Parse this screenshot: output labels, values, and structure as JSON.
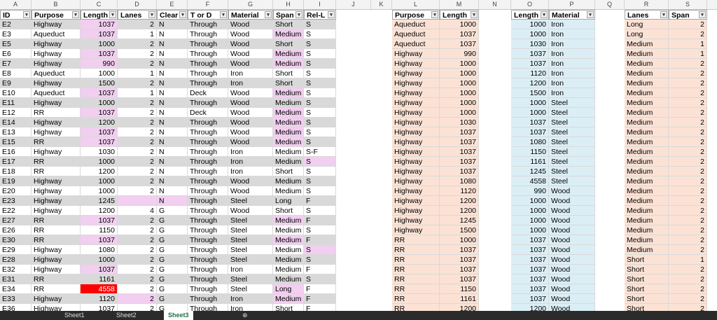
{
  "columns": [
    "A",
    "B",
    "C",
    "D",
    "E",
    "F",
    "G",
    "H",
    "I",
    "J",
    "K",
    "L",
    "M",
    "N",
    "O",
    "P",
    "Q",
    "R",
    "S"
  ],
  "main_headers": [
    "ID",
    "Purpose",
    "Length",
    "Lanes",
    "Clear",
    "T or D",
    "Material",
    "Span",
    "Rel-L"
  ],
  "main_rows": [
    [
      "E2",
      "Highway",
      "1037",
      "2",
      "N",
      "Through",
      "Wood",
      "Short",
      "S"
    ],
    [
      "E3",
      "Aqueduct",
      "1037",
      "1",
      "N",
      "Through",
      "Wood",
      "Medium",
      "S"
    ],
    [
      "E5",
      "Highway",
      "1000",
      "2",
      "N",
      "Through",
      "Wood",
      "Short",
      "S"
    ],
    [
      "E6",
      "Highway",
      "1037",
      "2",
      "N",
      "Through",
      "Wood",
      "Medium",
      "S"
    ],
    [
      "E7",
      "Highway",
      "990",
      "2",
      "N",
      "Through",
      "Wood",
      "Medium",
      "S"
    ],
    [
      "E8",
      "Aqueduct",
      "1000",
      "1",
      "N",
      "Through",
      "Iron",
      "Short",
      "S"
    ],
    [
      "E9",
      "Highway",
      "1500",
      "2",
      "N",
      "Through",
      "Iron",
      "Short",
      "S"
    ],
    [
      "E10",
      "Aqueduct",
      "1037",
      "1",
      "N",
      "Deck",
      "Wood",
      "Medium",
      "S"
    ],
    [
      "E11",
      "Highway",
      "1000",
      "2",
      "N",
      "Through",
      "Wood",
      "Medium",
      "S"
    ],
    [
      "E12",
      "RR",
      "1037",
      "2",
      "N",
      "Deck",
      "Wood",
      "Medium",
      "S"
    ],
    [
      "E14",
      "Highway",
      "1200",
      "2",
      "N",
      "Through",
      "Wood",
      "Medium",
      "S"
    ],
    [
      "E13",
      "Highway",
      "1037",
      "2",
      "N",
      "Through",
      "Wood",
      "Medium",
      "S"
    ],
    [
      "E15",
      "RR",
      "1037",
      "2",
      "N",
      "Through",
      "Wood",
      "Medium",
      "S"
    ],
    [
      "E16",
      "Highway",
      "1030",
      "2",
      "N",
      "Through",
      "Iron",
      "Medium",
      "S-F"
    ],
    [
      "E17",
      "RR",
      "1000",
      "2",
      "N",
      "Through",
      "Iron",
      "Medium",
      "S"
    ],
    [
      "E18",
      "RR",
      "1200",
      "2",
      "N",
      "Through",
      "Iron",
      "Short",
      "S"
    ],
    [
      "E19",
      "Highway",
      "1000",
      "2",
      "N",
      "Through",
      "Wood",
      "Medium",
      "S"
    ],
    [
      "E20",
      "Highway",
      "1000",
      "2",
      "N",
      "Through",
      "Wood",
      "Medium",
      "S"
    ],
    [
      "E23",
      "Highway",
      "1245",
      "",
      "N",
      "Through",
      "Steel",
      "Long",
      "F"
    ],
    [
      "E22",
      "Highway",
      "1200",
      "4",
      "G",
      "Through",
      "Wood",
      "Short",
      "S"
    ],
    [
      "E27",
      "RR",
      "1037",
      "2",
      "G",
      "Through",
      "Steel",
      "Medium",
      "F"
    ],
    [
      "E26",
      "RR",
      "1150",
      "2",
      "G",
      "Through",
      "Steel",
      "Medium",
      "S"
    ],
    [
      "E30",
      "RR",
      "1037",
      "2",
      "G",
      "Through",
      "Steel",
      "Medium",
      "F"
    ],
    [
      "E29",
      "Highway",
      "1080",
      "2",
      "G",
      "Through",
      "Steel",
      "Medium",
      "S"
    ],
    [
      "E28",
      "Highway",
      "1000",
      "2",
      "G",
      "Through",
      "Steel",
      "Medium",
      "S"
    ],
    [
      "E32",
      "Highway",
      "1037",
      "2",
      "G",
      "Through",
      "Iron",
      "Medium",
      "F"
    ],
    [
      "E31",
      "RR",
      "1161",
      "2",
      "G",
      "Through",
      "Steel",
      "Medium",
      "S"
    ],
    [
      "E34",
      "RR",
      "4558",
      "2",
      "G",
      "Through",
      "Steel",
      "Long",
      "F"
    ],
    [
      "E33",
      "Highway",
      "1120",
      "2",
      "G",
      "Through",
      "Iron",
      "Medium",
      "F"
    ],
    [
      "E36",
      "Highway",
      "1037",
      "2",
      "G",
      "Through",
      "Iron",
      "Short",
      "F"
    ]
  ],
  "t2_headers": [
    "Purpose",
    "Length"
  ],
  "t2_rows": [
    [
      "Aqueduct",
      "1000"
    ],
    [
      "Aqueduct",
      "1037"
    ],
    [
      "Aqueduct",
      "1037"
    ],
    [
      "Highway",
      "990"
    ],
    [
      "Highway",
      "1000"
    ],
    [
      "Highway",
      "1000"
    ],
    [
      "Highway",
      "1000"
    ],
    [
      "Highway",
      "1000"
    ],
    [
      "Highway",
      "1000"
    ],
    [
      "Highway",
      "1000"
    ],
    [
      "Highway",
      "1030"
    ],
    [
      "Highway",
      "1037"
    ],
    [
      "Highway",
      "1037"
    ],
    [
      "Highway",
      "1037"
    ],
    [
      "Highway",
      "1037"
    ],
    [
      "Highway",
      "1037"
    ],
    [
      "Highway",
      "1080"
    ],
    [
      "Highway",
      "1120"
    ],
    [
      "Highway",
      "1200"
    ],
    [
      "Highway",
      "1200"
    ],
    [
      "Highway",
      "1245"
    ],
    [
      "Highway",
      "1500"
    ],
    [
      "RR",
      "1000"
    ],
    [
      "RR",
      "1037"
    ],
    [
      "RR",
      "1037"
    ],
    [
      "RR",
      "1037"
    ],
    [
      "RR",
      "1037"
    ],
    [
      "RR",
      "1150"
    ],
    [
      "RR",
      "1161"
    ],
    [
      "RR",
      "1200"
    ]
  ],
  "t3_headers": [
    "Length",
    "Material"
  ],
  "t3_rows": [
    [
      "1000",
      "Iron"
    ],
    [
      "1000",
      "Iron"
    ],
    [
      "1030",
      "Iron"
    ],
    [
      "1037",
      "Iron"
    ],
    [
      "1037",
      "Iron"
    ],
    [
      "1120",
      "Iron"
    ],
    [
      "1200",
      "Iron"
    ],
    [
      "1500",
      "Iron"
    ],
    [
      "1000",
      "Steel"
    ],
    [
      "1000",
      "Steel"
    ],
    [
      "1037",
      "Steel"
    ],
    [
      "1037",
      "Steel"
    ],
    [
      "1080",
      "Steel"
    ],
    [
      "1150",
      "Steel"
    ],
    [
      "1161",
      "Steel"
    ],
    [
      "1245",
      "Steel"
    ],
    [
      "4558",
      "Steel"
    ],
    [
      "990",
      "Wood"
    ],
    [
      "1000",
      "Wood"
    ],
    [
      "1000",
      "Wood"
    ],
    [
      "1000",
      "Wood"
    ],
    [
      "1000",
      "Wood"
    ],
    [
      "1037",
      "Wood"
    ],
    [
      "1037",
      "Wood"
    ],
    [
      "1037",
      "Wood"
    ],
    [
      "1037",
      "Wood"
    ],
    [
      "1037",
      "Wood"
    ],
    [
      "1037",
      "Wood"
    ],
    [
      "1037",
      "Wood"
    ],
    [
      "1200",
      "Wood"
    ]
  ],
  "t4_headers": [
    "Lanes",
    "Span"
  ],
  "t4_rows": [
    [
      "Long",
      "2"
    ],
    [
      "Long",
      "2"
    ],
    [
      "Medium",
      "1"
    ],
    [
      "Medium",
      "1"
    ],
    [
      "Medium",
      "2"
    ],
    [
      "Medium",
      "2"
    ],
    [
      "Medium",
      "2"
    ],
    [
      "Medium",
      "2"
    ],
    [
      "Medium",
      "2"
    ],
    [
      "Medium",
      "2"
    ],
    [
      "Medium",
      "2"
    ],
    [
      "Medium",
      "2"
    ],
    [
      "Medium",
      "2"
    ],
    [
      "Medium",
      "2"
    ],
    [
      "Medium",
      "2"
    ],
    [
      "Medium",
      "2"
    ],
    [
      "Medium",
      "2"
    ],
    [
      "Medium",
      "2"
    ],
    [
      "Medium",
      "2"
    ],
    [
      "Medium",
      "2"
    ],
    [
      "Medium",
      "2"
    ],
    [
      "Medium",
      "2"
    ],
    [
      "Medium",
      "2"
    ],
    [
      "Medium",
      "2"
    ],
    [
      "Short",
      "1"
    ],
    [
      "Short",
      "2"
    ],
    [
      "Short",
      "2"
    ],
    [
      "Short",
      "2"
    ],
    [
      "Short",
      "2"
    ],
    [
      "Short",
      "2"
    ]
  ],
  "tabs": [
    "Sheet1",
    "Sheet2",
    "Sheet3"
  ],
  "colors": {
    "gray": "#d9d9d9",
    "pink": "#f2cef0",
    "red": "#ff0000",
    "peach": "#fbe2d5",
    "blue": "#dbeef6",
    "header_orange": "#f4b183",
    "header_blue": "#9dc3e6"
  }
}
